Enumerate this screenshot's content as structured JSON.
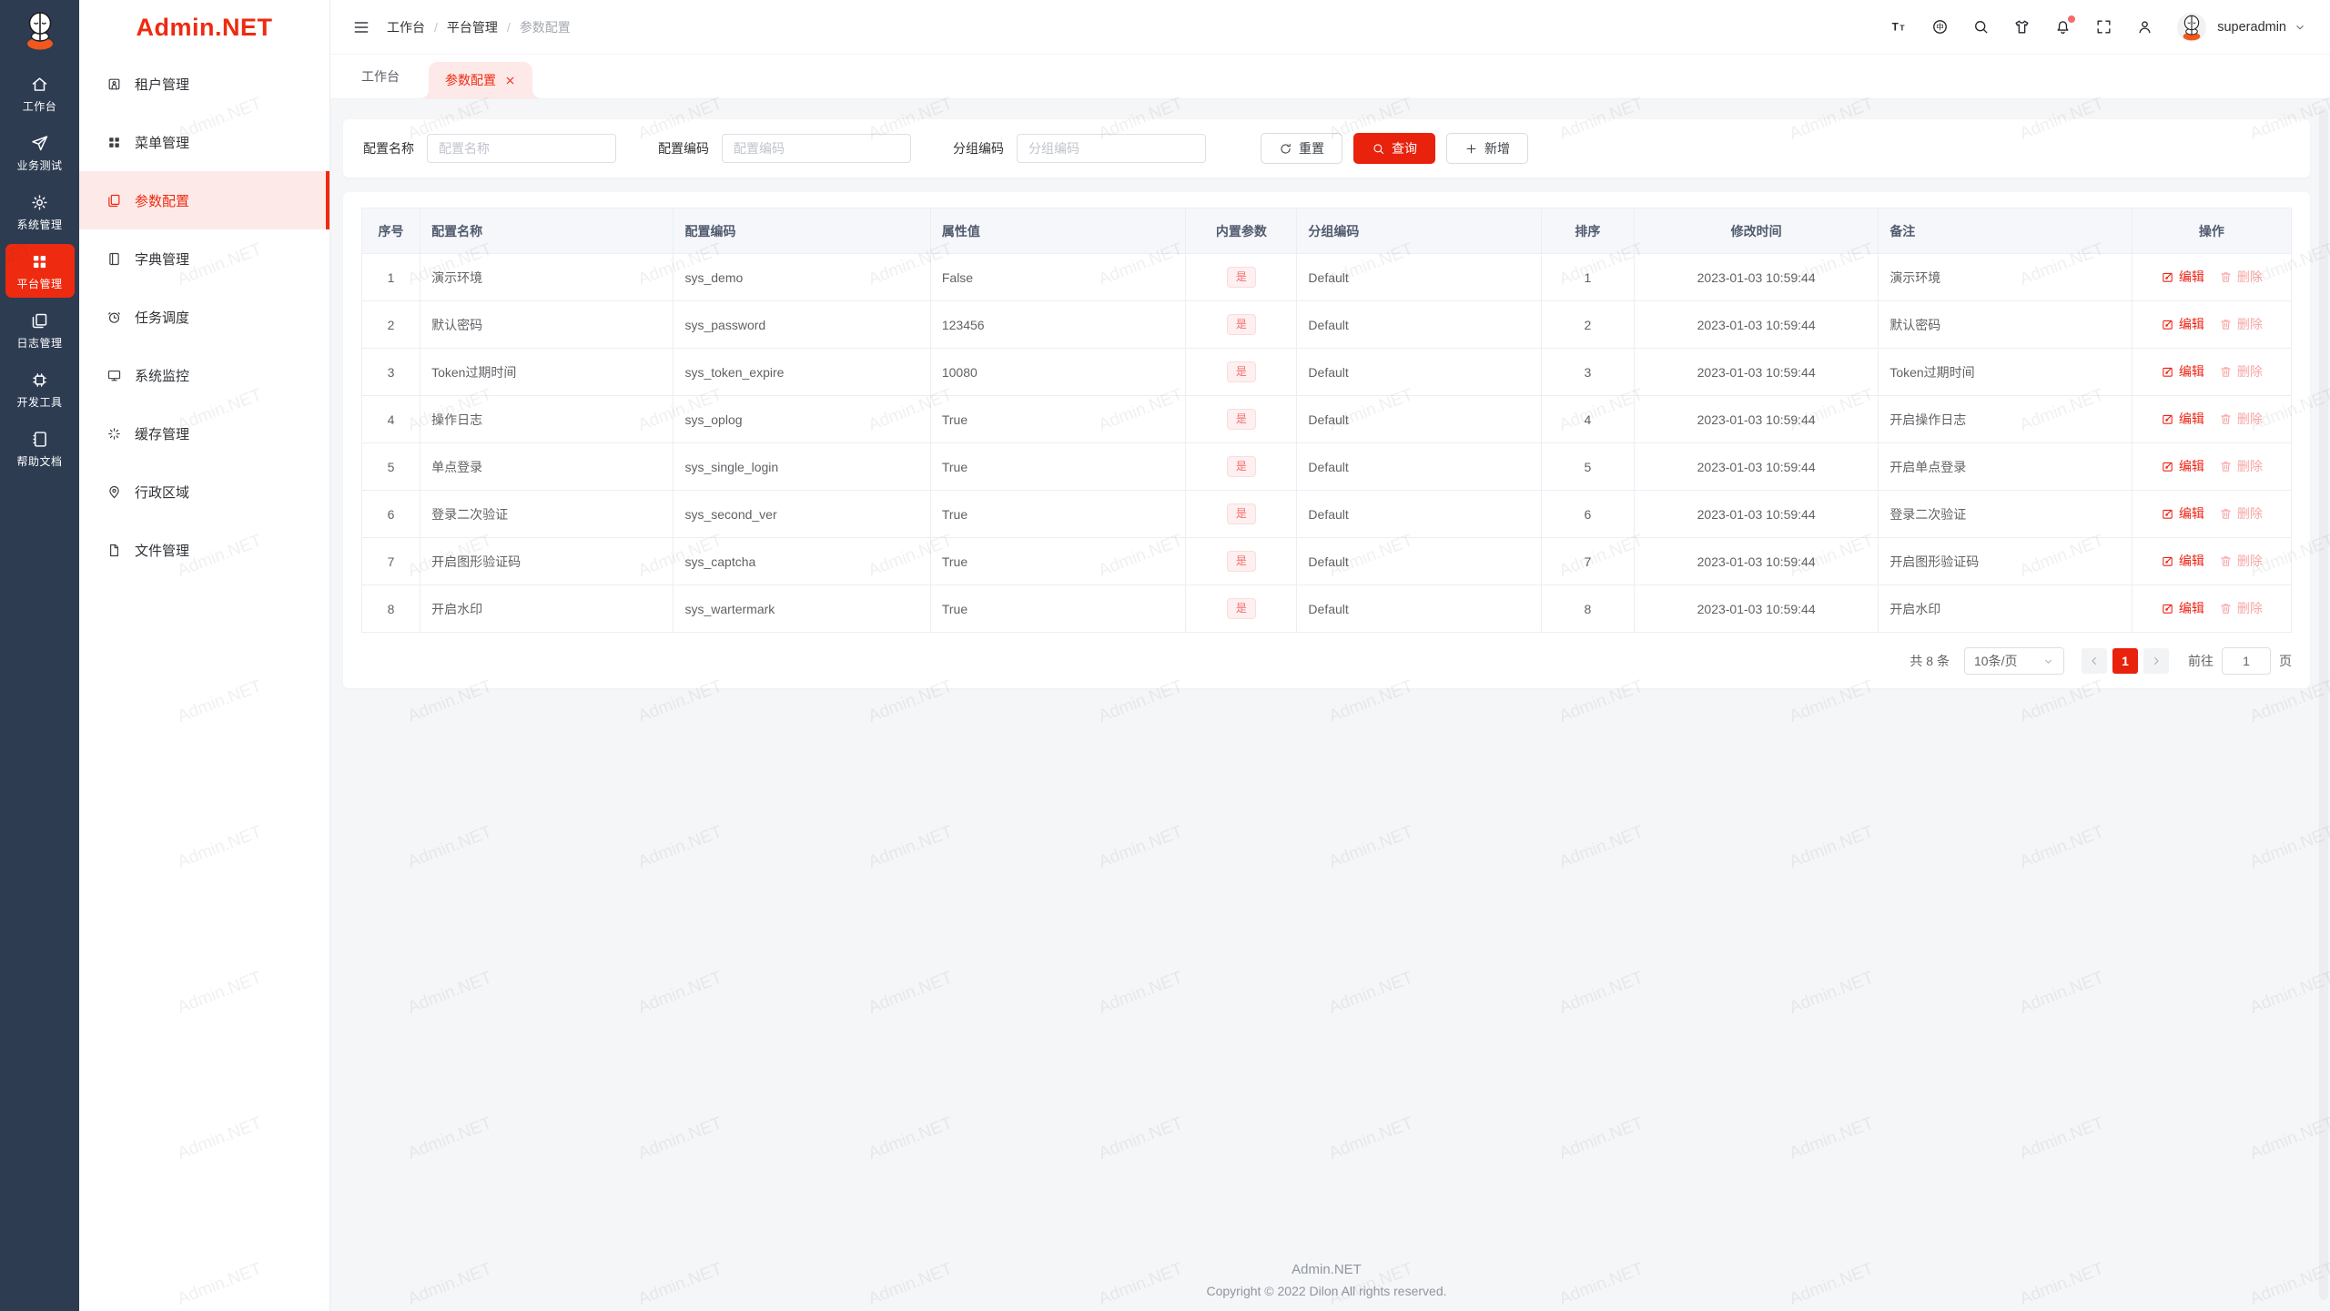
{
  "watermark": "Admin.NET",
  "colors": {
    "primary": "#ee2a10",
    "rail_bg": "#2e3c52",
    "active_light": "#fdeae8",
    "badge_text": "#f56c6c",
    "badge_bg": "#fef0f0"
  },
  "rail": {
    "items": [
      {
        "label": "工作台",
        "icon": "home-icon",
        "active": false
      },
      {
        "label": "业务测试",
        "icon": "send-icon",
        "active": false
      },
      {
        "label": "系统管理",
        "icon": "gear-icon",
        "active": false
      },
      {
        "label": "平台管理",
        "icon": "grid-icon",
        "active": true
      },
      {
        "label": "日志管理",
        "icon": "copy-docs-icon",
        "active": false
      },
      {
        "label": "开发工具",
        "icon": "chip-icon",
        "active": false
      },
      {
        "label": "帮助文档",
        "icon": "notebook-icon",
        "active": false
      }
    ]
  },
  "sidebar": {
    "logo": "Admin.NET",
    "items": [
      {
        "label": "租户管理",
        "icon": "tenant-icon",
        "active": false
      },
      {
        "label": "菜单管理",
        "icon": "menu-grid-icon",
        "active": false
      },
      {
        "label": "参数配置",
        "icon": "config-copy-icon",
        "active": true
      },
      {
        "label": "字典管理",
        "icon": "dict-book-icon",
        "active": false
      },
      {
        "label": "任务调度",
        "icon": "alarm-clock-icon",
        "active": false
      },
      {
        "label": "系统监控",
        "icon": "monitor-icon",
        "active": false
      },
      {
        "label": "缓存管理",
        "icon": "cache-spinner-icon",
        "active": false
      },
      {
        "label": "行政区域",
        "icon": "location-pin-icon",
        "active": false
      },
      {
        "label": "文件管理",
        "icon": "file-doc-icon",
        "active": false
      }
    ]
  },
  "topbar": {
    "breadcrumb": [
      "工作台",
      "平台管理",
      "参数配置"
    ],
    "icons": [
      {
        "name": "font-size-icon"
      },
      {
        "name": "language-icon"
      },
      {
        "name": "search-icon"
      },
      {
        "name": "theme-icon"
      },
      {
        "name": "bell-icon",
        "badge": true
      },
      {
        "name": "fullscreen-icon"
      },
      {
        "name": "profile-icon"
      }
    ],
    "user": "superadmin"
  },
  "tabs": [
    {
      "label": "工作台",
      "active": false,
      "closable": false
    },
    {
      "label": "参数配置",
      "active": true,
      "closable": true
    }
  ],
  "search": {
    "fields": [
      {
        "name": "config-name-input",
        "label": "配置名称",
        "placeholder": "配置名称",
        "value": ""
      },
      {
        "name": "config-code-input",
        "label": "配置编码",
        "placeholder": "配置编码",
        "value": ""
      },
      {
        "name": "group-code-input",
        "label": "分组编码",
        "placeholder": "分组编码",
        "value": ""
      }
    ],
    "buttons": {
      "reset": "重置",
      "query": "查询",
      "add": "新增"
    }
  },
  "table": {
    "headers": [
      "序号",
      "配置名称",
      "配置编码",
      "属性值",
      "内置参数",
      "分组编码",
      "排序",
      "修改时间",
      "备注",
      "操作"
    ],
    "actions": {
      "edit": "编辑",
      "delete": "删除"
    },
    "rows": [
      {
        "index": "1",
        "name": "演示环境",
        "code": "sys_demo",
        "value": "False",
        "builtin": "是",
        "group": "Default",
        "sort": "1",
        "time": "2023-01-03 10:59:44",
        "remark": "演示环境"
      },
      {
        "index": "2",
        "name": "默认密码",
        "code": "sys_password",
        "value": "123456",
        "builtin": "是",
        "group": "Default",
        "sort": "2",
        "time": "2023-01-03 10:59:44",
        "remark": "默认密码"
      },
      {
        "index": "3",
        "name": "Token过期时间",
        "code": "sys_token_expire",
        "value": "10080",
        "builtin": "是",
        "group": "Default",
        "sort": "3",
        "time": "2023-01-03 10:59:44",
        "remark": "Token过期时间"
      },
      {
        "index": "4",
        "name": "操作日志",
        "code": "sys_oplog",
        "value": "True",
        "builtin": "是",
        "group": "Default",
        "sort": "4",
        "time": "2023-01-03 10:59:44",
        "remark": "开启操作日志"
      },
      {
        "index": "5",
        "name": "单点登录",
        "code": "sys_single_login",
        "value": "True",
        "builtin": "是",
        "group": "Default",
        "sort": "5",
        "time": "2023-01-03 10:59:44",
        "remark": "开启单点登录"
      },
      {
        "index": "6",
        "name": "登录二次验证",
        "code": "sys_second_ver",
        "value": "True",
        "builtin": "是",
        "group": "Default",
        "sort": "6",
        "time": "2023-01-03 10:59:44",
        "remark": "登录二次验证"
      },
      {
        "index": "7",
        "name": "开启图形验证码",
        "code": "sys_captcha",
        "value": "True",
        "builtin": "是",
        "group": "Default",
        "sort": "7",
        "time": "2023-01-03 10:59:44",
        "remark": "开启图形验证码"
      },
      {
        "index": "8",
        "name": "开启水印",
        "code": "sys_wartermark",
        "value": "True",
        "builtin": "是",
        "group": "Default",
        "sort": "8",
        "time": "2023-01-03 10:59:44",
        "remark": "开启水印"
      }
    ]
  },
  "pagination": {
    "total": "共 8 条",
    "page_size": "10条/页",
    "current": "1",
    "goto_label": "前往",
    "goto_value": "1",
    "page_unit": "页"
  },
  "footer": {
    "line1": "Admin.NET",
    "line2": "Copyright © 2022 Dilon All rights reserved."
  }
}
